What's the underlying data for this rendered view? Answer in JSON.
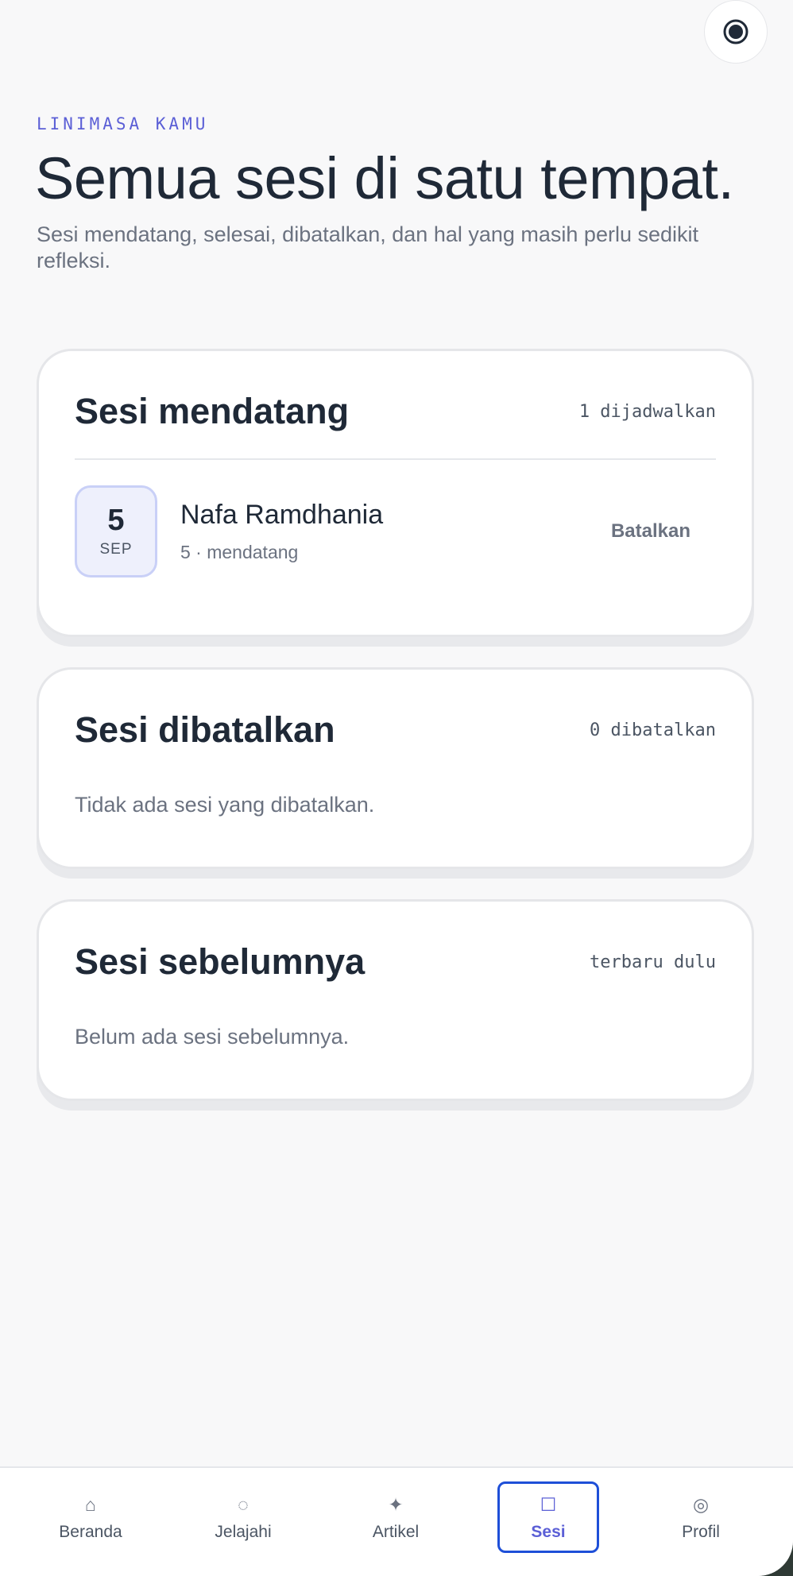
{
  "header": {
    "eyebrow": "LINIMASA KAMU",
    "title": "Semua sesi di satu tempat.",
    "subtitle": "Sesi mendatang, selesai, dibatalkan, dan hal yang masih perlu sedikit refleksi."
  },
  "upcoming": {
    "title": "Sesi mendatang",
    "meta": "1 dijadwalkan",
    "sessions": [
      {
        "day": "5",
        "month": "SEP",
        "name": "Nafa Ramdhania",
        "sub": "5 · mendatang",
        "action": "Batalkan"
      }
    ]
  },
  "cancelled": {
    "title": "Sesi dibatalkan",
    "meta": "0 dibatalkan",
    "empty": "Tidak ada sesi yang dibatalkan."
  },
  "previous": {
    "title": "Sesi sebelumnya",
    "meta": "terbaru dulu",
    "empty": "Belum ada sesi sebelumnya."
  },
  "nav": {
    "items": [
      {
        "label": "Beranda",
        "icon": "⌂",
        "icon_name": "home-icon"
      },
      {
        "label": "Jelajahi",
        "icon": "◌",
        "icon_name": "explore-icon"
      },
      {
        "label": "Artikel",
        "icon": "✦",
        "icon_name": "sparkle-icon"
      },
      {
        "label": "Sesi",
        "icon": "☐",
        "icon_name": "square-icon"
      },
      {
        "label": "Profil",
        "icon": "◎",
        "icon_name": "profile-icon"
      }
    ],
    "active": "Sesi"
  },
  "colors": {
    "accent": "#5b5fd6",
    "active_outline": "#1e4fd8",
    "text_primary": "#1f2937",
    "text_muted": "#6b7280"
  }
}
